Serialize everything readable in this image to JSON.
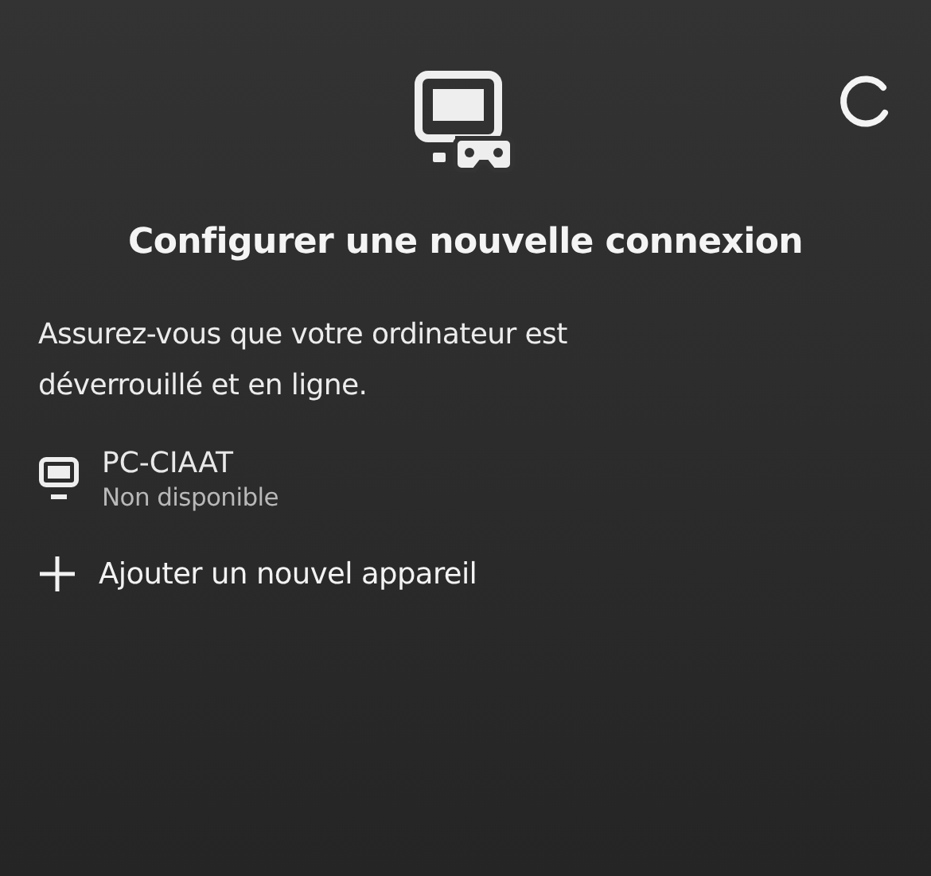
{
  "title": "Configurer une nouvelle connexion",
  "description": "Assurez-vous que votre ordinateur est déverrouillé et en ligne.",
  "devices": [
    {
      "name": "PC-CIAAT",
      "status": "Non disponible",
      "available": false
    }
  ],
  "add_device": {
    "label": "Ajouter un nouvel appareil"
  },
  "loading": true
}
